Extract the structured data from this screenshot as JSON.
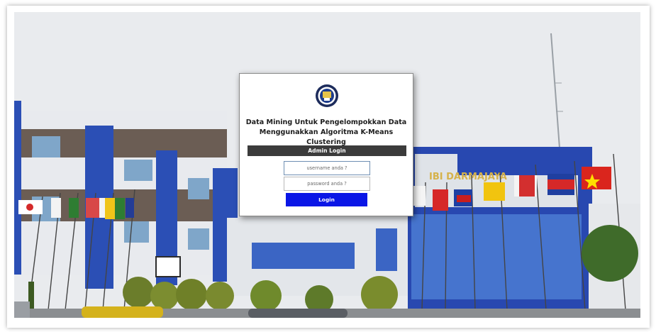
{
  "login": {
    "title_line1": "Data Mining Untuk Pengelompokkan Data",
    "title_line2": "Menggunakkan Algoritma K-Means Clustering",
    "section_label": "Admin Login",
    "username_placeholder": "username anda ?",
    "password_placeholder": "password anda ?",
    "login_label": "Login"
  },
  "background": {
    "building_sign": "IBI DARMAJAYA"
  },
  "colors": {
    "section_bar": "#3b3b3b",
    "login_button": "#0a16e6",
    "building_blue": "#2b4fb5"
  }
}
